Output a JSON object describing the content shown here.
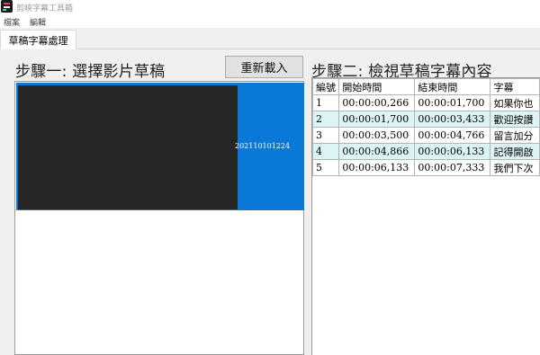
{
  "window": {
    "title": "剪映字幕工具箱",
    "icon": "app-logo-icon"
  },
  "menu": {
    "items": [
      {
        "label": "檔案"
      },
      {
        "label": "編輯"
      }
    ]
  },
  "tabs": [
    {
      "label": "草稿字幕處理",
      "active": true
    }
  ],
  "step1": {
    "title": "步驟一: 選擇影片草稿",
    "reload_label": "重新載入",
    "videos": [
      {
        "name": "202110101224",
        "selected": true
      }
    ]
  },
  "step2": {
    "title": "步驟二: 檢視草稿字幕內容",
    "columns": [
      "編號",
      "開始時間",
      "結束時間",
      "字幕"
    ],
    "rows": [
      {
        "index": "1",
        "start": "00:00:00,266",
        "end": "00:00:01,700",
        "text": "如果你也"
      },
      {
        "index": "2",
        "start": "00:00:01,700",
        "end": "00:00:03,433",
        "text": "歡迎按讚"
      },
      {
        "index": "3",
        "start": "00:00:03,500",
        "end": "00:00:04,766",
        "text": "留言加分"
      },
      {
        "index": "4",
        "start": "00:00:04,866",
        "end": "00:00:06,133",
        "text": "記得開啟"
      },
      {
        "index": "5",
        "start": "00:00:06,133",
        "end": "00:00:07,333",
        "text": "我們下次"
      }
    ]
  },
  "colors": {
    "selection": "#0a78d7",
    "row_alt": "#dcf4f5",
    "panel_bg": "#f0f0f0"
  }
}
